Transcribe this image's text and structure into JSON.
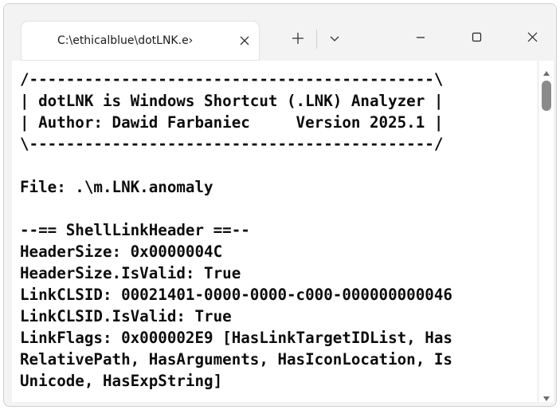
{
  "tab": {
    "title": "C:\\ethicalblue\\dotLNK.e›",
    "close_icon": "close-icon"
  },
  "toolbar": {
    "new_tab_icon": "plus-icon",
    "dropdown_icon": "chevron-down-icon"
  },
  "window_controls": {
    "minimize_icon": "minimize-icon",
    "maximize_icon": "maximize-icon",
    "close_icon": "close-icon"
  },
  "terminal": {
    "lines": [
      "/--------------------------------------------\\",
      "| dotLNK is Windows Shortcut (.LNK) Analyzer |",
      "| Author: Dawid Farbaniec     Version 2025.1 |",
      "\\--------------------------------------------/",
      "",
      "File: .\\m.LNK.anomaly",
      "",
      "--== ShellLinkHeader ==--",
      "HeaderSize: 0x0000004C",
      "HeaderSize.IsValid: True",
      "LinkCLSID: 00021401-0000-0000-c000-000000000046",
      "LinkCLSID.IsValid: True",
      "LinkFlags: 0x000002E9 [HasLinkTargetIDList, Has",
      "RelativePath, HasArguments, HasIconLocation, Is",
      "Unicode, HasExpString]"
    ]
  },
  "colors": {
    "titlebar_bg": "#f3f3f3",
    "terminal_bg": "#ffffff",
    "terminal_fg": "#0c0c0c",
    "scroll_thumb": "#8a8a8a"
  }
}
